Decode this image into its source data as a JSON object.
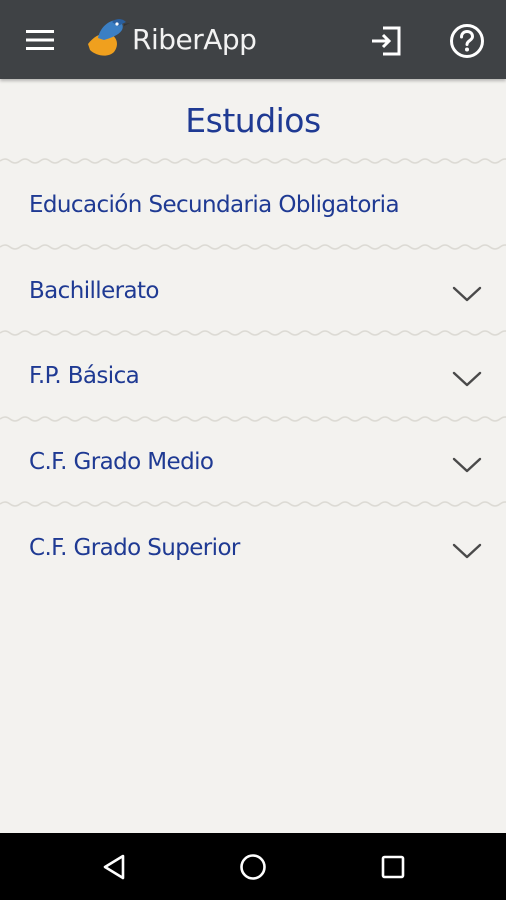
{
  "app_bar": {
    "title": "RiberApp",
    "icons": {
      "menu": "menu-icon",
      "logo": "kingfisher-logo",
      "login": "login-icon",
      "help": "help-icon"
    },
    "background": "#3f4245"
  },
  "page": {
    "title": "Estudios",
    "accent_color": "#1f3a93",
    "items": [
      {
        "label": "Educación Secundaria Obligatoria",
        "expandable": false
      },
      {
        "label": "Bachillerato",
        "expandable": true
      },
      {
        "label": "F.P. Básica",
        "expandable": true
      },
      {
        "label": "C.F. Grado Medio",
        "expandable": true
      },
      {
        "label": "C.F. Grado Superior",
        "expandable": true
      }
    ]
  },
  "system_nav": {
    "icons": [
      "back-icon",
      "home-icon",
      "recents-icon"
    ]
  }
}
